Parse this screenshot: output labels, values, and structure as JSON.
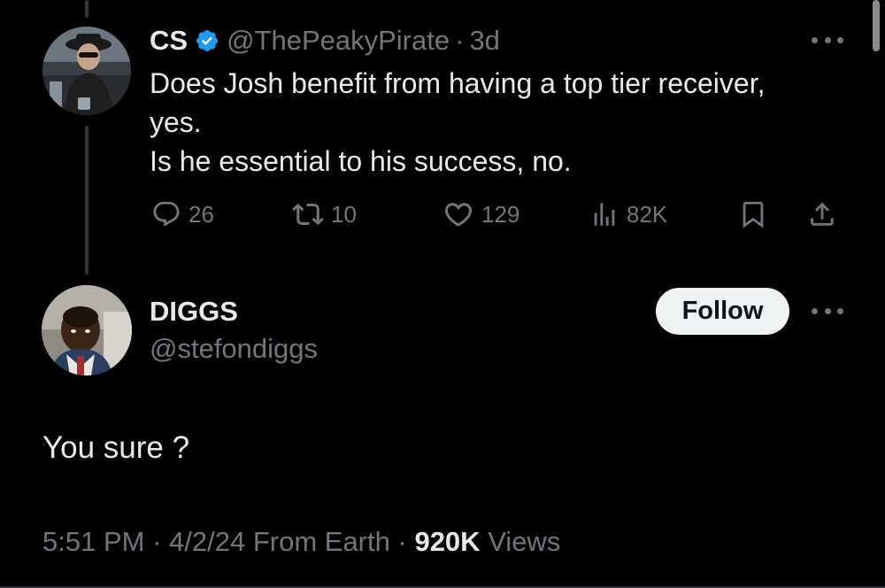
{
  "parent_tweet": {
    "display_name": "CS",
    "handle": "@ThePeakyPirate",
    "separator": "·",
    "time": "3d",
    "text_lines": [
      "Does Josh benefit from having a top tier receiver,",
      "yes.",
      "Is he essential to his success, no."
    ],
    "actions": {
      "replies": "26",
      "retweets": "10",
      "likes": "129",
      "views": "82K"
    }
  },
  "main_tweet": {
    "display_name": "DIGGS",
    "handle": "@stefondiggs",
    "follow_label": "Follow",
    "text": "You sure ?",
    "meta": {
      "time": "5:51 PM",
      "sep1": "·",
      "date_source": "4/2/24 From Earth",
      "sep2": "·",
      "views_count": "920K",
      "views_label": "Views"
    }
  },
  "colors": {
    "background": "#000000",
    "primary_text": "#e7e9ea",
    "secondary_text": "#71767b",
    "verified_blue": "#1d9bf0",
    "follow_bg": "#eff3f4"
  },
  "icons": {
    "verified": "verified-badge-icon",
    "reply": "reply-icon",
    "retweet": "retweet-icon",
    "like": "heart-icon",
    "views": "views-chart-icon",
    "bookmark": "bookmark-icon",
    "share": "share-icon",
    "more": "more-dots-icon"
  }
}
